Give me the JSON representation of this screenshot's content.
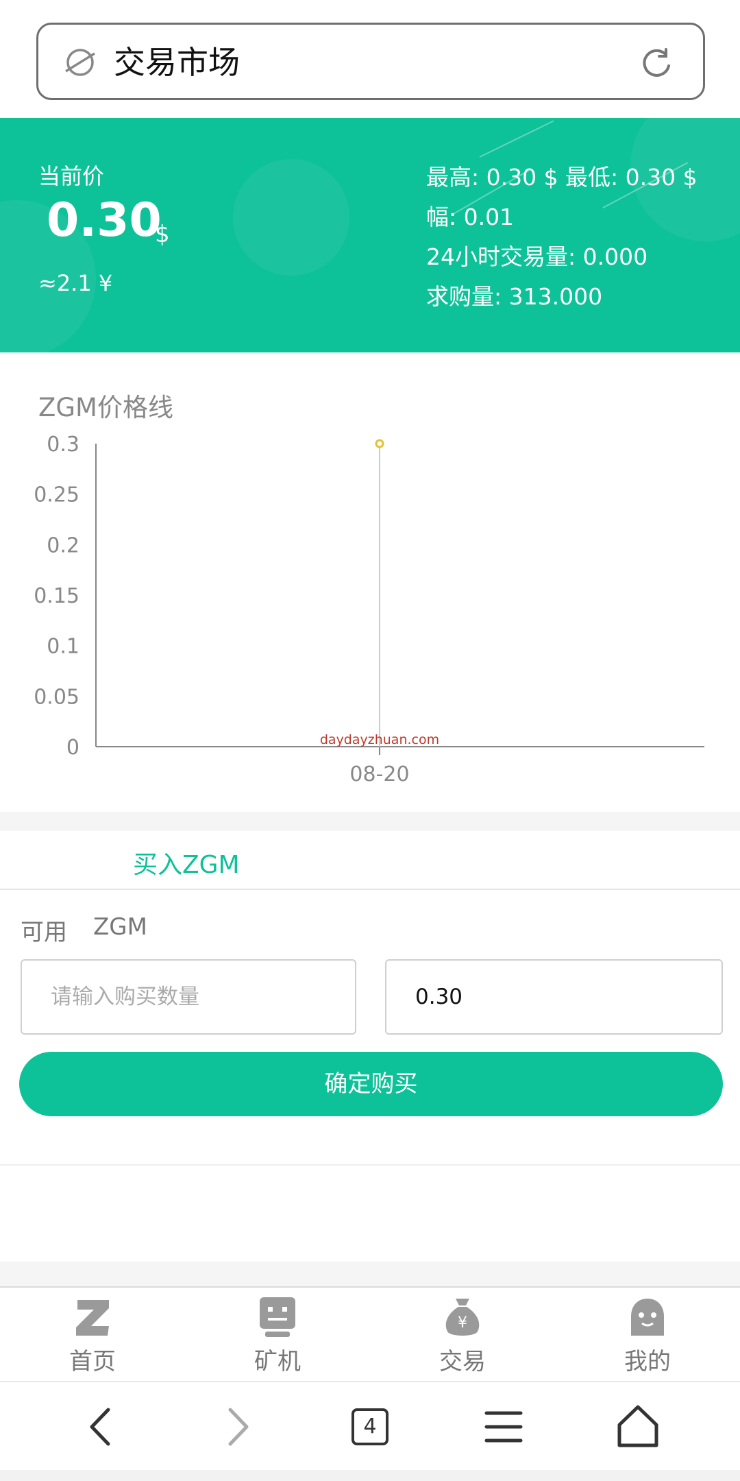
{
  "address_bar": {
    "title": "交易市场"
  },
  "header": {
    "current_price_label": "当前价",
    "current_price": "0.30",
    "price_unit": "$",
    "cny_equiv": "≈2.1 ¥",
    "stats": {
      "high_low": "最高: 0.30 $  最低: 0.30 $",
      "change": "幅: 0.01",
      "volume_24h": "24小时交易量: 0.000",
      "buy_volume": "求购量: 313.000"
    },
    "colors": {
      "accent": "#0dc198"
    }
  },
  "chart_data": {
    "type": "line",
    "title": "ZGM价格线",
    "categories": [
      "08-20"
    ],
    "series": [
      {
        "values": [
          0.3
        ]
      }
    ],
    "ylim": [
      0,
      0.3
    ],
    "yticks": [
      "0.3",
      "0.25",
      "0.2",
      "0.15",
      "0.1",
      "0.05",
      "0"
    ],
    "watermark": "daydayzhuan.com",
    "point_color": "#e6c22e"
  },
  "buy": {
    "tab_label": "买入ZGM",
    "available_label": "可用",
    "available_unit": "ZGM",
    "quantity_placeholder": "请输入购买数量",
    "price_value": "0.30",
    "confirm_label": "确定购买"
  },
  "tabbar": {
    "items": [
      {
        "label": "首页",
        "icon": "z-logo-icon"
      },
      {
        "label": "矿机",
        "icon": "robot-icon"
      },
      {
        "label": "交易",
        "icon": "money-bag-icon"
      },
      {
        "label": "我的",
        "icon": "ghost-avatar-icon"
      }
    ]
  },
  "browser_nav": {
    "tab_count": "4"
  }
}
